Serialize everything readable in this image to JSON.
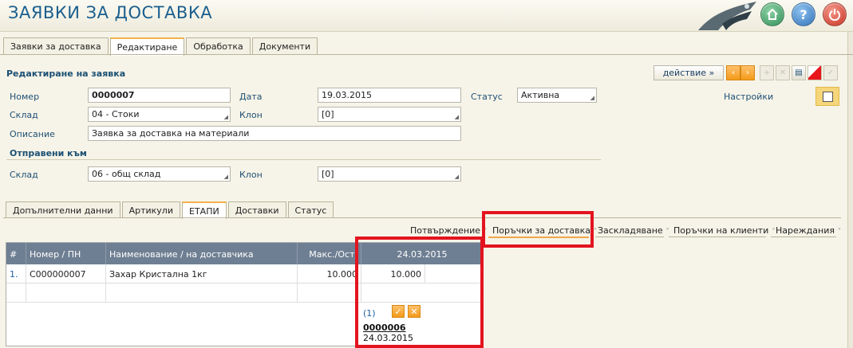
{
  "header": {
    "title": "ЗАЯВКИ ЗА ДОСТАВКА",
    "help_glyph": "?",
    "buttons": [
      "home-icon",
      "help-icon",
      "power-icon"
    ]
  },
  "top_tabs": [
    "Заявки за доставка",
    "Редактиране",
    "Обработка",
    "Документи"
  ],
  "form": {
    "section_title": "Редактиране на заявка",
    "labels": {
      "number": "Номер",
      "date": "Дата",
      "status": "Статус",
      "warehouse": "Склад",
      "branch": "Клон",
      "description": "Описание",
      "settings": "Настройки"
    },
    "values": {
      "number": "0000007",
      "date": "19.03.2015",
      "status": "Активна",
      "warehouse": "04 - Стоки",
      "branch": "[0]",
      "description": "Заявка за доставка на материали"
    },
    "sent_to": {
      "title": "Отправени към",
      "warehouse_label": "Склад",
      "warehouse_value": "06 - общ склад",
      "branch_label": "Клон",
      "branch_value": "[0]"
    },
    "action_label": "действие »"
  },
  "inner_tabs": [
    "Допълнителни данни",
    "Артикули",
    "ЕТАПИ",
    "Доставки",
    "Статус"
  ],
  "stages": [
    "Потвърждение",
    "Поръчки за доставка",
    "Заскладяване",
    "Поръчки на клиенти",
    "Нареждания"
  ],
  "stage_tick": "°",
  "table": {
    "columns": [
      "#",
      "Номер / ПН",
      "Наименование / на доставчика",
      "Макс./Ост.",
      "24.03.2015"
    ],
    "rows": [
      {
        "index": "1.",
        "code": "C000000007",
        "name": "Захар Кристална 1кг",
        "max": "10.000",
        "date_qty": "10.000"
      }
    ],
    "order_count": "(1)",
    "order_number": "0000006",
    "order_date": "24.03.2015"
  },
  "colors": {
    "accent": "#1b5f8e",
    "highlight": "#e3141f",
    "header_grid": "#6f7f93",
    "active_tab": "#f1b24a"
  }
}
